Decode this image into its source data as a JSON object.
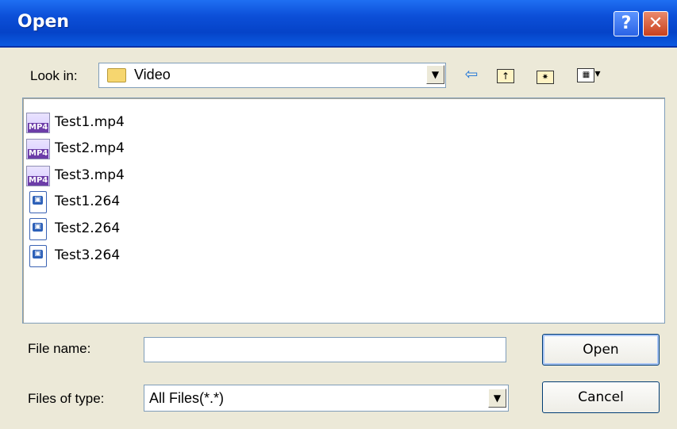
{
  "window": {
    "title": "Open",
    "help_glyph": "?",
    "close_glyph": "✕"
  },
  "look_in": {
    "label": "Look in:",
    "value": "Video"
  },
  "toolbar": [
    "back-icon",
    "up-folder-icon",
    "new-folder-icon",
    "view-menu-icon"
  ],
  "files": [
    {
      "name": "Test1.mp4",
      "icon": "mp4-file-icon"
    },
    {
      "name": "Test2.mp4",
      "icon": "mp4-file-icon"
    },
    {
      "name": "Test3.mp4",
      "icon": "mp4-file-icon"
    },
    {
      "name": "Test1.264",
      "icon": "video-file-icon"
    },
    {
      "name": "Test2.264",
      "icon": "video-file-icon"
    },
    {
      "name": "Test3.264",
      "icon": "video-file-icon"
    }
  ],
  "file_name": {
    "label": "File name:",
    "value": ""
  },
  "file_type": {
    "label": "Files of type:",
    "value": "All Files(*.*)"
  },
  "buttons": {
    "open": "Open",
    "cancel": "Cancel"
  }
}
